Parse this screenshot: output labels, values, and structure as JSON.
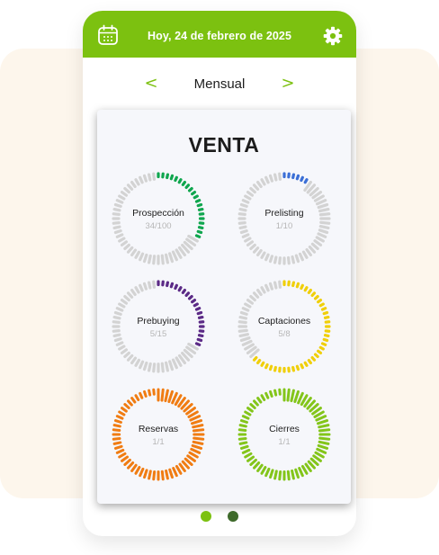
{
  "header": {
    "date": "Hoy, 24 de febrero de 2025",
    "calendar_icon": "calendar-icon",
    "settings_icon": "gear-icon",
    "color": "#7cc110"
  },
  "period": {
    "prev_symbol": "<",
    "label": "Mensual",
    "next_symbol": ">"
  },
  "card": {
    "title": "VENTA"
  },
  "rings": [
    {
      "label": "Prospección",
      "value_text": "34/100",
      "current": 34,
      "total": 100,
      "color": "#0fa64e"
    },
    {
      "label": "Prelisting",
      "value_text": "1/10",
      "current": 1,
      "total": 10,
      "color": "#3b6fd6"
    },
    {
      "label": "Prebuying",
      "value_text": "5/15",
      "current": 5,
      "total": 15,
      "color": "#5b2a86"
    },
    {
      "label": "Captaciones",
      "value_text": "5/8",
      "current": 5,
      "total": 8,
      "color": "#f0cf0a"
    },
    {
      "label": "Reservas",
      "value_text": "1/1",
      "current": 1,
      "total": 1,
      "color": "#f07c12"
    },
    {
      "label": "Cierres",
      "value_text": "1/1",
      "current": 1,
      "total": 1,
      "color": "#83c51a"
    }
  ],
  "pagination": {
    "total": 2,
    "active_index": 0,
    "active_color": "#7cc110",
    "inactive_color": "#3e6a2a"
  },
  "theme": {
    "track_color": "#d3d3d3"
  }
}
